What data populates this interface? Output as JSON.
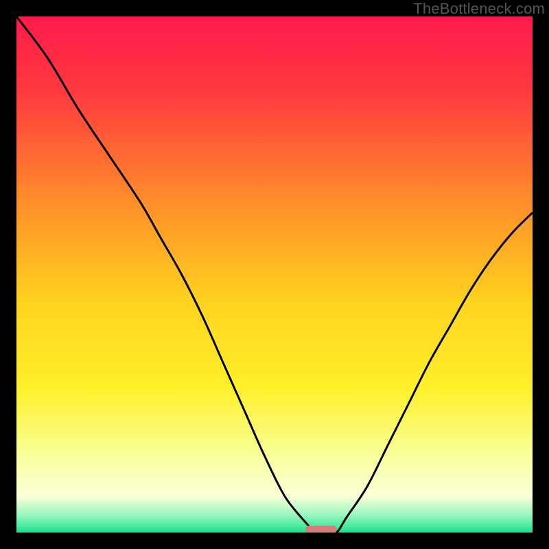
{
  "attribution": "TheBottleneck.com",
  "chart_data": {
    "type": "line",
    "title": "",
    "xlabel": "",
    "ylabel": "",
    "xlim": [
      0,
      100
    ],
    "ylim": [
      0,
      100
    ],
    "grid": false,
    "legend": false,
    "series": [
      {
        "name": "bottleneck-curve",
        "x": [
          0,
          6,
          12,
          18,
          24,
          28,
          32,
          36,
          40,
          44,
          48,
          52,
          56,
          58,
          60,
          62,
          64,
          68,
          72,
          76,
          80,
          84,
          88,
          92,
          96,
          100
        ],
        "y": [
          100,
          92,
          82,
          73,
          64,
          57,
          50,
          42,
          33,
          24,
          15,
          7,
          2,
          0,
          0,
          0,
          3,
          9,
          17,
          25,
          33,
          40,
          47,
          53,
          58,
          62
        ]
      }
    ],
    "marker": {
      "name": "sweet-spot",
      "x_range": [
        56,
        62
      ],
      "y": 0,
      "color": "#d97b77"
    },
    "background": {
      "type": "vertical-gradient",
      "stops": [
        {
          "offset": 0.0,
          "color": "#ff1a4b"
        },
        {
          "offset": 0.15,
          "color": "#ff3b3f"
        },
        {
          "offset": 0.35,
          "color": "#ff8a2b"
        },
        {
          "offset": 0.55,
          "color": "#ffd21f"
        },
        {
          "offset": 0.72,
          "color": "#fff02a"
        },
        {
          "offset": 0.85,
          "color": "#f8ff9a"
        },
        {
          "offset": 0.93,
          "color": "#faffd8"
        },
        {
          "offset": 0.965,
          "color": "#9af7c0"
        },
        {
          "offset": 1.0,
          "color": "#1be28a"
        }
      ]
    }
  }
}
